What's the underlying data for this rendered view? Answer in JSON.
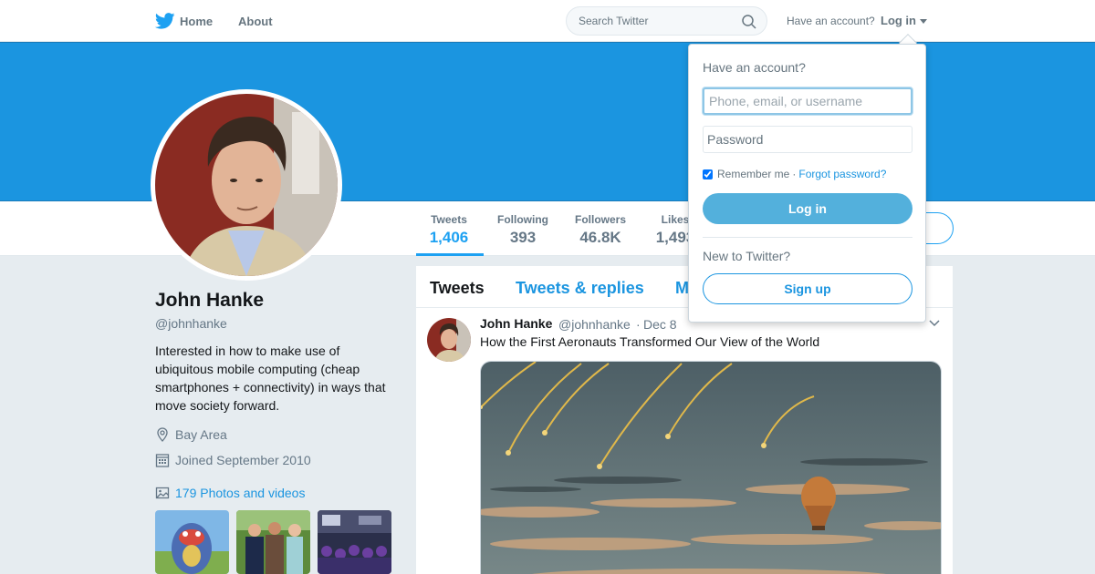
{
  "topnav": {
    "home_label": "Home",
    "about_label": "About",
    "search_placeholder": "Search Twitter",
    "have_account": "Have an account?",
    "login_label": "Log in"
  },
  "colors": {
    "accent": "#1da1f2",
    "banner": "#1b95e0",
    "login_button": "#53b0dc",
    "page_background": "#e6ecf0"
  },
  "profile": {
    "name": "John Hanke",
    "handle": "@johnhanke",
    "bio": "Interested in how to make use of ubiquitous mobile computing (cheap smartphones + connectivity) in ways that move society forward.",
    "location": "Bay Area",
    "joined": "Joined September 2010",
    "media_link": "179 Photos and videos"
  },
  "stats": [
    {
      "label": "Tweets",
      "value": "1,406"
    },
    {
      "label": "Following",
      "value": "393"
    },
    {
      "label": "Followers",
      "value": "46.8K"
    },
    {
      "label": "Likes",
      "value": "1,493"
    }
  ],
  "timeline": {
    "tabs": [
      "Tweets",
      "Tweets & replies",
      "Media"
    ],
    "tweet": {
      "name": "John Hanke",
      "handle": "@johnhanke",
      "dot": "·",
      "date": "Dec 8",
      "text": "How the First Aeronauts Transformed Our View of the World"
    }
  },
  "login_dropdown": {
    "title": "Have an account?",
    "username_placeholder": "Phone, email, or username",
    "password_placeholder": "Password",
    "remember_label": "Remember me",
    "separator": "·",
    "forgot_label": "Forgot password?",
    "login_button": "Log in",
    "new_label": "New to Twitter?",
    "signup_button": "Sign up"
  }
}
